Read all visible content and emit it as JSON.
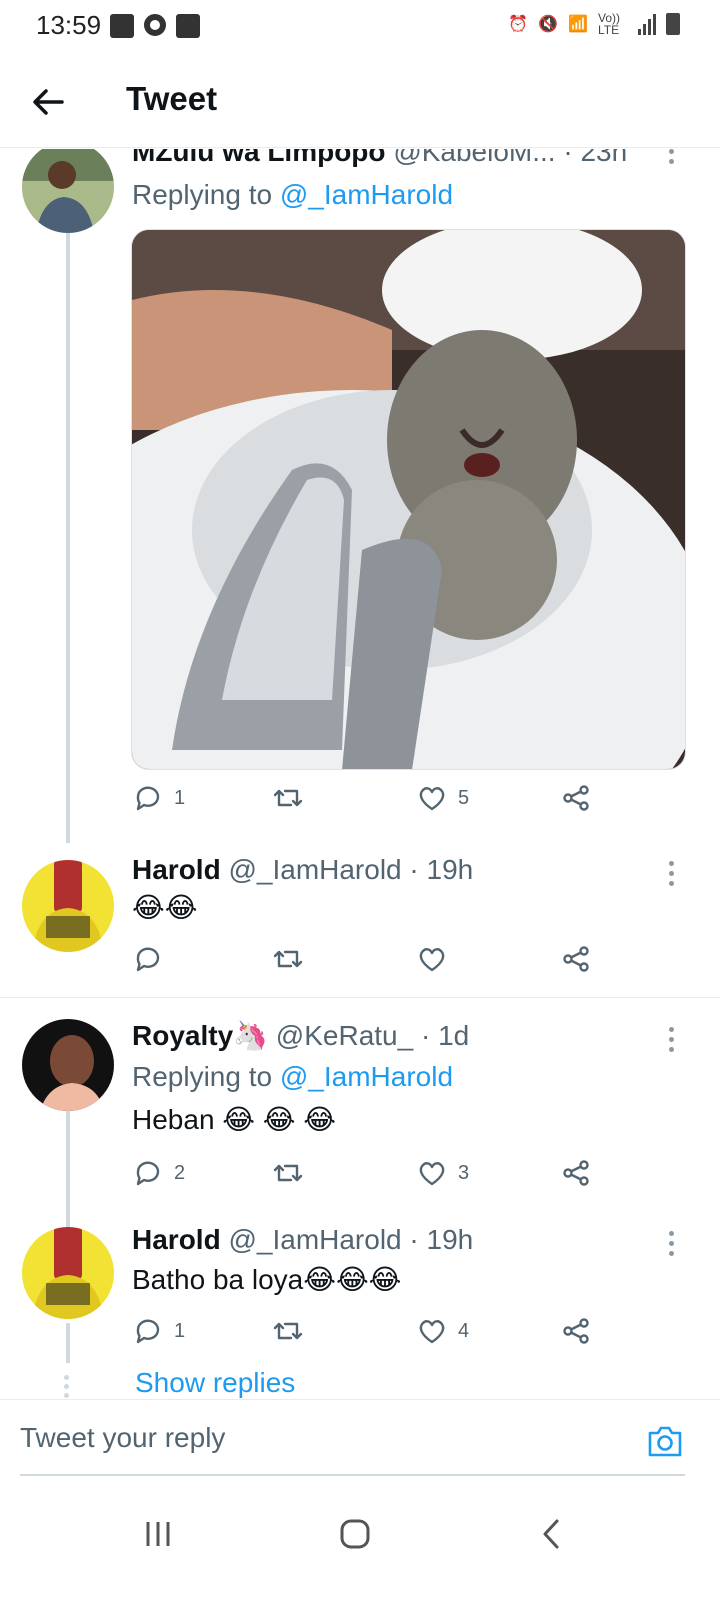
{
  "status_bar": {
    "time": "13:59",
    "network": "Vo)) LTE"
  },
  "header": {
    "title": "Tweet"
  },
  "tweets": [
    {
      "name": "MZulu wa Limpopo",
      "handle": "@KabeloM...",
      "time": "· 23h",
      "replying_prefix": "Replying to ",
      "replying_to": "@_IamHarold",
      "image_alt": "crying kitten with soap foam on head at sink faucet",
      "stats": {
        "replies": "1",
        "retweets": "",
        "likes": "5"
      }
    },
    {
      "name": "Harold",
      "handle": "@_IamHarold",
      "time": "· 19h",
      "text": "😂😂",
      "stats": {
        "replies": "",
        "retweets": "",
        "likes": ""
      }
    },
    {
      "name": "Royalty🦄",
      "handle": "@KeRatu_",
      "time": "· 1d",
      "replying_prefix": "Replying to ",
      "replying_to": "@_IamHarold",
      "text": "Heban 😂 😂 😂",
      "stats": {
        "replies": "2",
        "retweets": "",
        "likes": "3"
      }
    },
    {
      "name": "Harold",
      "handle": "@_IamHarold",
      "time": "· 19h",
      "text": "Batho ba loya😂😂😂",
      "stats": {
        "replies": "1",
        "retweets": "",
        "likes": "4"
      }
    }
  ],
  "show_replies": "Show replies",
  "reply_bar": {
    "placeholder": "Tweet your reply"
  },
  "colors": {
    "link": "#1d9bf0",
    "secondary_text": "#536471",
    "divider": "#e6ecf0"
  }
}
